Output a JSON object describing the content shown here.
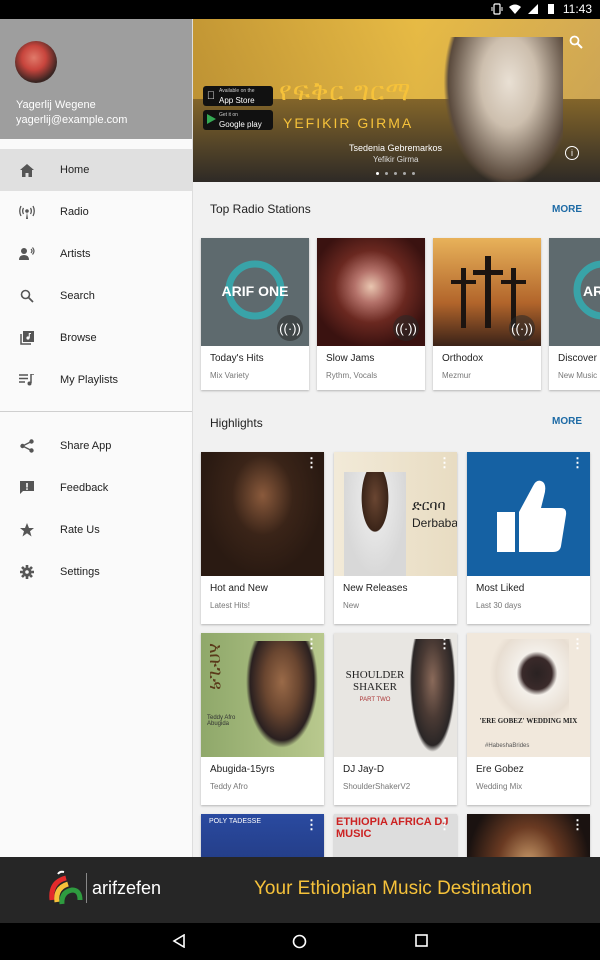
{
  "status_bar": {
    "time": "11:43"
  },
  "drawer": {
    "user": {
      "name": "Yagerlij Wegene",
      "email": "yagerlij@example.com"
    },
    "nav_primary": [
      {
        "label": "Home",
        "icon": "home-icon",
        "active": true
      },
      {
        "label": "Radio",
        "icon": "radio-icon"
      },
      {
        "label": "Artists",
        "icon": "artists-icon"
      },
      {
        "label": "Search",
        "icon": "search-icon"
      },
      {
        "label": "Browse",
        "icon": "browse-icon"
      },
      {
        "label": "My Playlists",
        "icon": "playlist-icon"
      }
    ],
    "nav_secondary": [
      {
        "label": "Share App",
        "icon": "share-icon"
      },
      {
        "label": "Feedback",
        "icon": "feedback-icon"
      },
      {
        "label": "Rate Us",
        "icon": "star-icon"
      },
      {
        "label": "Settings",
        "icon": "gear-icon"
      }
    ]
  },
  "hero": {
    "title_amharic": "የፍቅር ግርማ",
    "title_latin": "YEFIKIR GIRMA",
    "artist": "Tsedenia Gebremarkos",
    "album": "Yefikir Girma",
    "app_store": {
      "small": "Available on the",
      "label": "App Store"
    },
    "google_play": {
      "small": "Get it on",
      "label": "Google play"
    },
    "slide_count": 5,
    "active_slide": 1
  },
  "radio": {
    "title": "Top Radio Stations",
    "more": "MORE",
    "stations": [
      {
        "title": "Today's Hits",
        "subtitle": "Mix Variety",
        "art_text": "ARIF ONE"
      },
      {
        "title": "Slow Jams",
        "subtitle": "Rythm, Vocals"
      },
      {
        "title": "Orthodox",
        "subtitle": "Mezmur"
      },
      {
        "title": "Discover",
        "subtitle": "New Music",
        "art_text": "ARIF"
      }
    ]
  },
  "highlights": {
    "title": "Highlights",
    "more": "MORE",
    "items": [
      {
        "title": "Hot and New",
        "subtitle": "Latest Hits!"
      },
      {
        "title": "New Releases",
        "subtitle": "New",
        "art_text_amharic": "ድርባባ",
        "art_text": "Derbaba"
      },
      {
        "title": "Most Liked",
        "subtitle": "Last 30 days"
      },
      {
        "title": "Abugida-15yrs",
        "subtitle": "Teddy Afro",
        "art_text_amharic": "አቡጊዳ",
        "art_text": "Teddy Afro Abugida"
      },
      {
        "title": "DJ Jay-D",
        "subtitle": "ShoulderShakerV2",
        "art_text": "SHOULDER SHAKER",
        "art_sub": "PART TWO"
      },
      {
        "title": "Ere Gobez",
        "subtitle": "Wedding Mix",
        "art_text": "'ERE GOBEZ' WEDDING MIX",
        "art_tag": "#HabeshaBrides"
      },
      {
        "title": "",
        "subtitle": "",
        "art_text": "POLY TADESSE"
      },
      {
        "title": "",
        "subtitle": "",
        "art_text": "ETHIOPIA AFRICA DJ MUSIC"
      },
      {
        "title": "",
        "subtitle": ""
      }
    ]
  },
  "banner": {
    "logo": "arifzefen",
    "tagline": "Your Ethiopian Music Destination"
  },
  "colors": {
    "accent": "#1d6aa5",
    "brand_yellow": "#f6c23a",
    "drawer_header": "#9e9e9e"
  }
}
